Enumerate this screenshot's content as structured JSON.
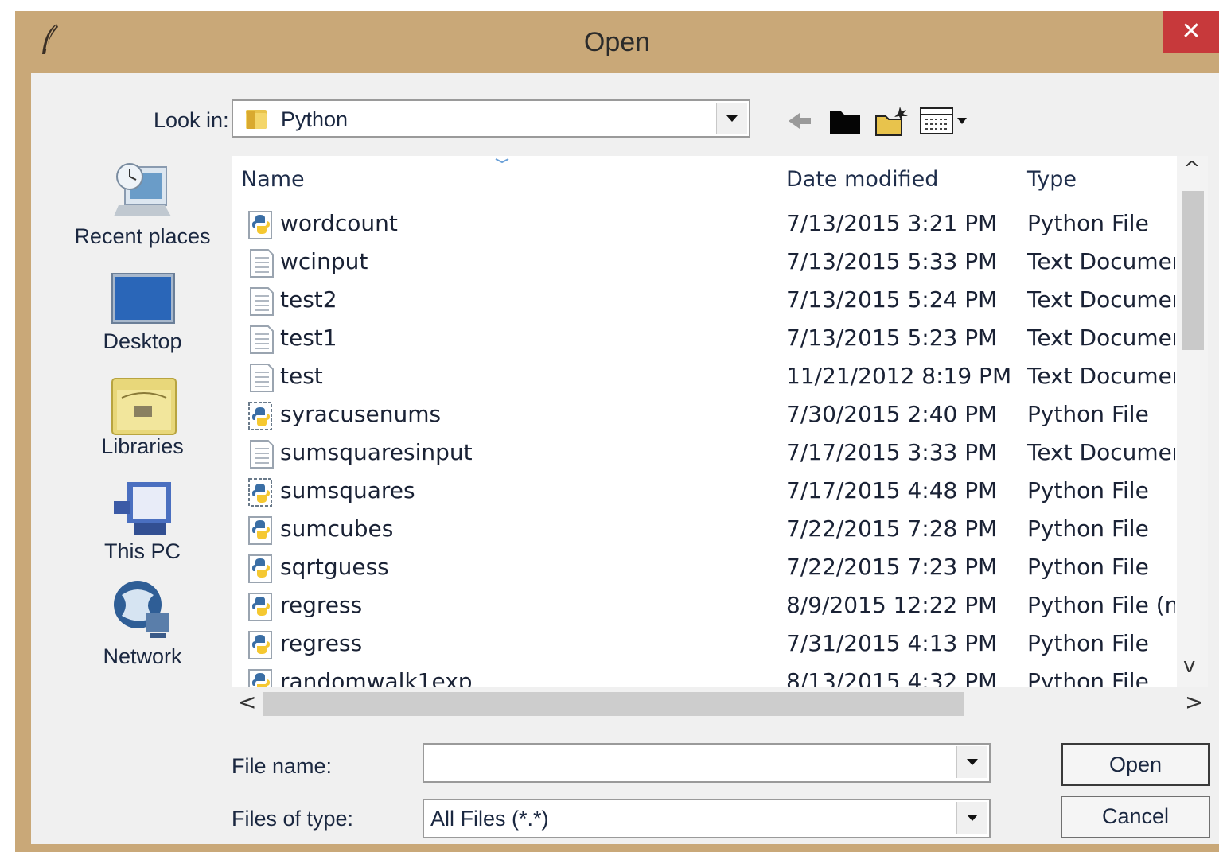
{
  "window": {
    "title": "Open",
    "close_glyph": "✕"
  },
  "toolbar": {
    "look_in_label": "Look in:",
    "look_in_value": "Python",
    "icons": [
      "back-arrow-icon",
      "up-folder-icon",
      "new-folder-icon",
      "view-menu-icon"
    ]
  },
  "places": [
    {
      "label": "Recent places",
      "icon": "recent-places-icon"
    },
    {
      "label": "Desktop",
      "icon": "desktop-icon"
    },
    {
      "label": "Libraries",
      "icon": "libraries-icon"
    },
    {
      "label": "This PC",
      "icon": "this-pc-icon"
    },
    {
      "label": "Network",
      "icon": "network-icon"
    }
  ],
  "list": {
    "columns": {
      "name": "Name",
      "date": "Date modified",
      "type": "Type"
    },
    "rows": [
      {
        "name": "wordcount",
        "date": "7/13/2015 3:21 PM",
        "type": "Python File",
        "icon": "python"
      },
      {
        "name": "wcinput",
        "date": "7/13/2015 5:33 PM",
        "type": "Text Document",
        "icon": "text"
      },
      {
        "name": "test2",
        "date": "7/13/2015 5:24 PM",
        "type": "Text Document",
        "icon": "text"
      },
      {
        "name": "test1",
        "date": "7/13/2015 5:23 PM",
        "type": "Text Document",
        "icon": "text"
      },
      {
        "name": "test",
        "date": "11/21/2012 8:19 PM",
        "type": "Text Document",
        "icon": "text"
      },
      {
        "name": "syracusenums",
        "date": "7/30/2015 2:40 PM",
        "type": "Python File",
        "icon": "python-script"
      },
      {
        "name": "sumsquaresinput",
        "date": "7/17/2015 3:33 PM",
        "type": "Text Document",
        "icon": "text"
      },
      {
        "name": "sumsquares",
        "date": "7/17/2015 4:48 PM",
        "type": "Python File",
        "icon": "python-script"
      },
      {
        "name": "sumcubes",
        "date": "7/22/2015 7:28 PM",
        "type": "Python File",
        "icon": "python"
      },
      {
        "name": "sqrtguess",
        "date": "7/22/2015 7:23 PM",
        "type": "Python File",
        "icon": "python"
      },
      {
        "name": "regress",
        "date": "8/9/2015 12:22 PM",
        "type": "Python File (n",
        "icon": "python"
      },
      {
        "name": "regress",
        "date": "7/31/2015 4:13 PM",
        "type": "Python File",
        "icon": "python"
      },
      {
        "name": "randomwalk1exp",
        "date": "8/13/2015 4:32 PM",
        "type": "Python File",
        "icon": "python"
      }
    ]
  },
  "scroll": {
    "up": "^",
    "down": "v",
    "left": "<",
    "right": ">"
  },
  "form": {
    "file_name_label": "File name:",
    "file_name_value": "",
    "file_type_label": "Files of type:",
    "file_type_value": "All Files (*.*)",
    "open_label": "Open",
    "cancel_label": "Cancel"
  }
}
